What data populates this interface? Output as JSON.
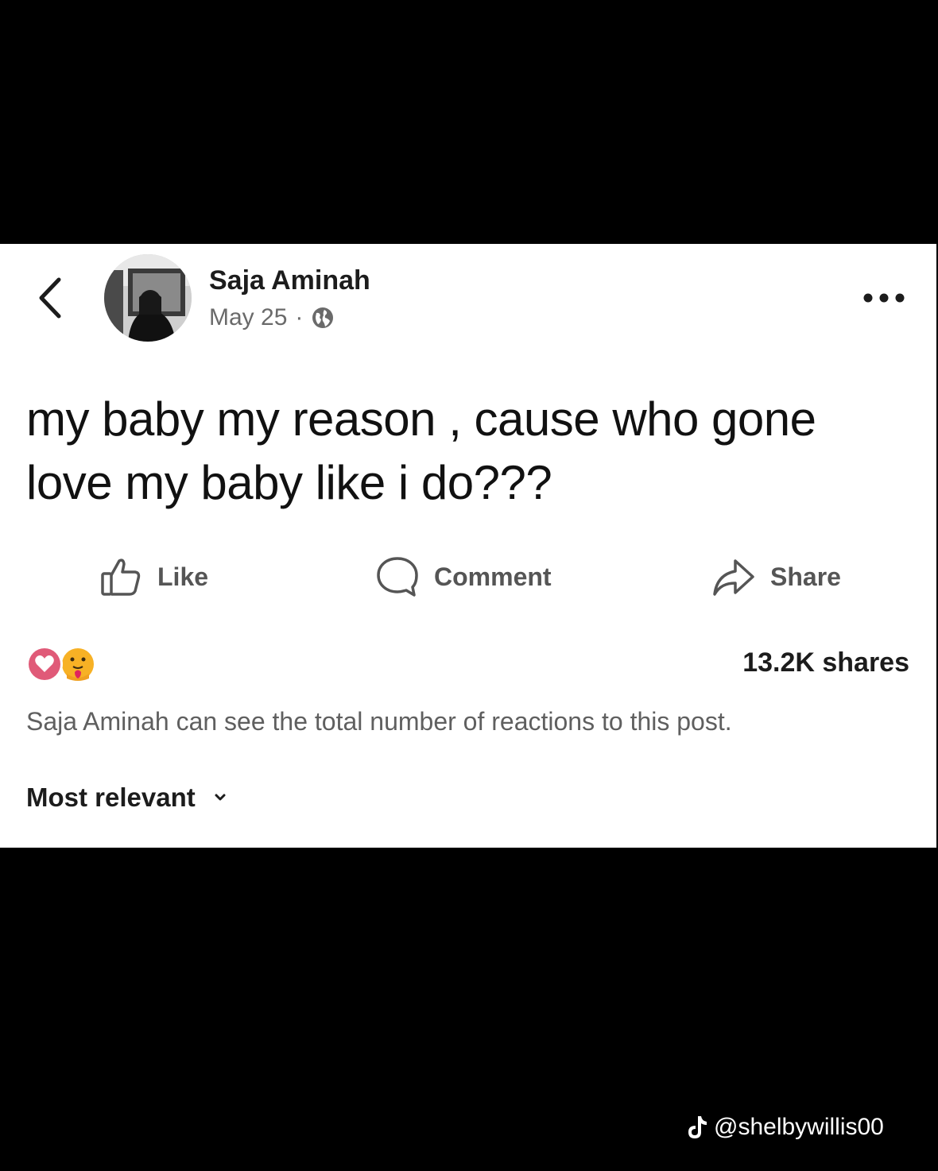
{
  "post": {
    "author": "Saja Aminah",
    "date": "May 25",
    "separator": "·",
    "privacy_icon": "globe-icon",
    "text": "my baby my reason , cause who gone love my baby like i do???"
  },
  "actions": {
    "like_label": "Like",
    "comment_label": "Comment",
    "share_label": "Share"
  },
  "stats": {
    "reaction_icons": [
      "heart-reaction-icon",
      "care-reaction-icon"
    ],
    "shares": "13.2K shares",
    "reaction_note": "Saja Aminah can see the total number of reactions to this post."
  },
  "comments": {
    "sort_label": "Most relevant"
  },
  "watermark": {
    "handle": "@shelbywillis00"
  },
  "colors": {
    "background": "#000000",
    "card": "#ffffff",
    "text": "#111111",
    "muted": "#6a6a6a",
    "heart": "#e0245e",
    "care": "#f7b125"
  }
}
